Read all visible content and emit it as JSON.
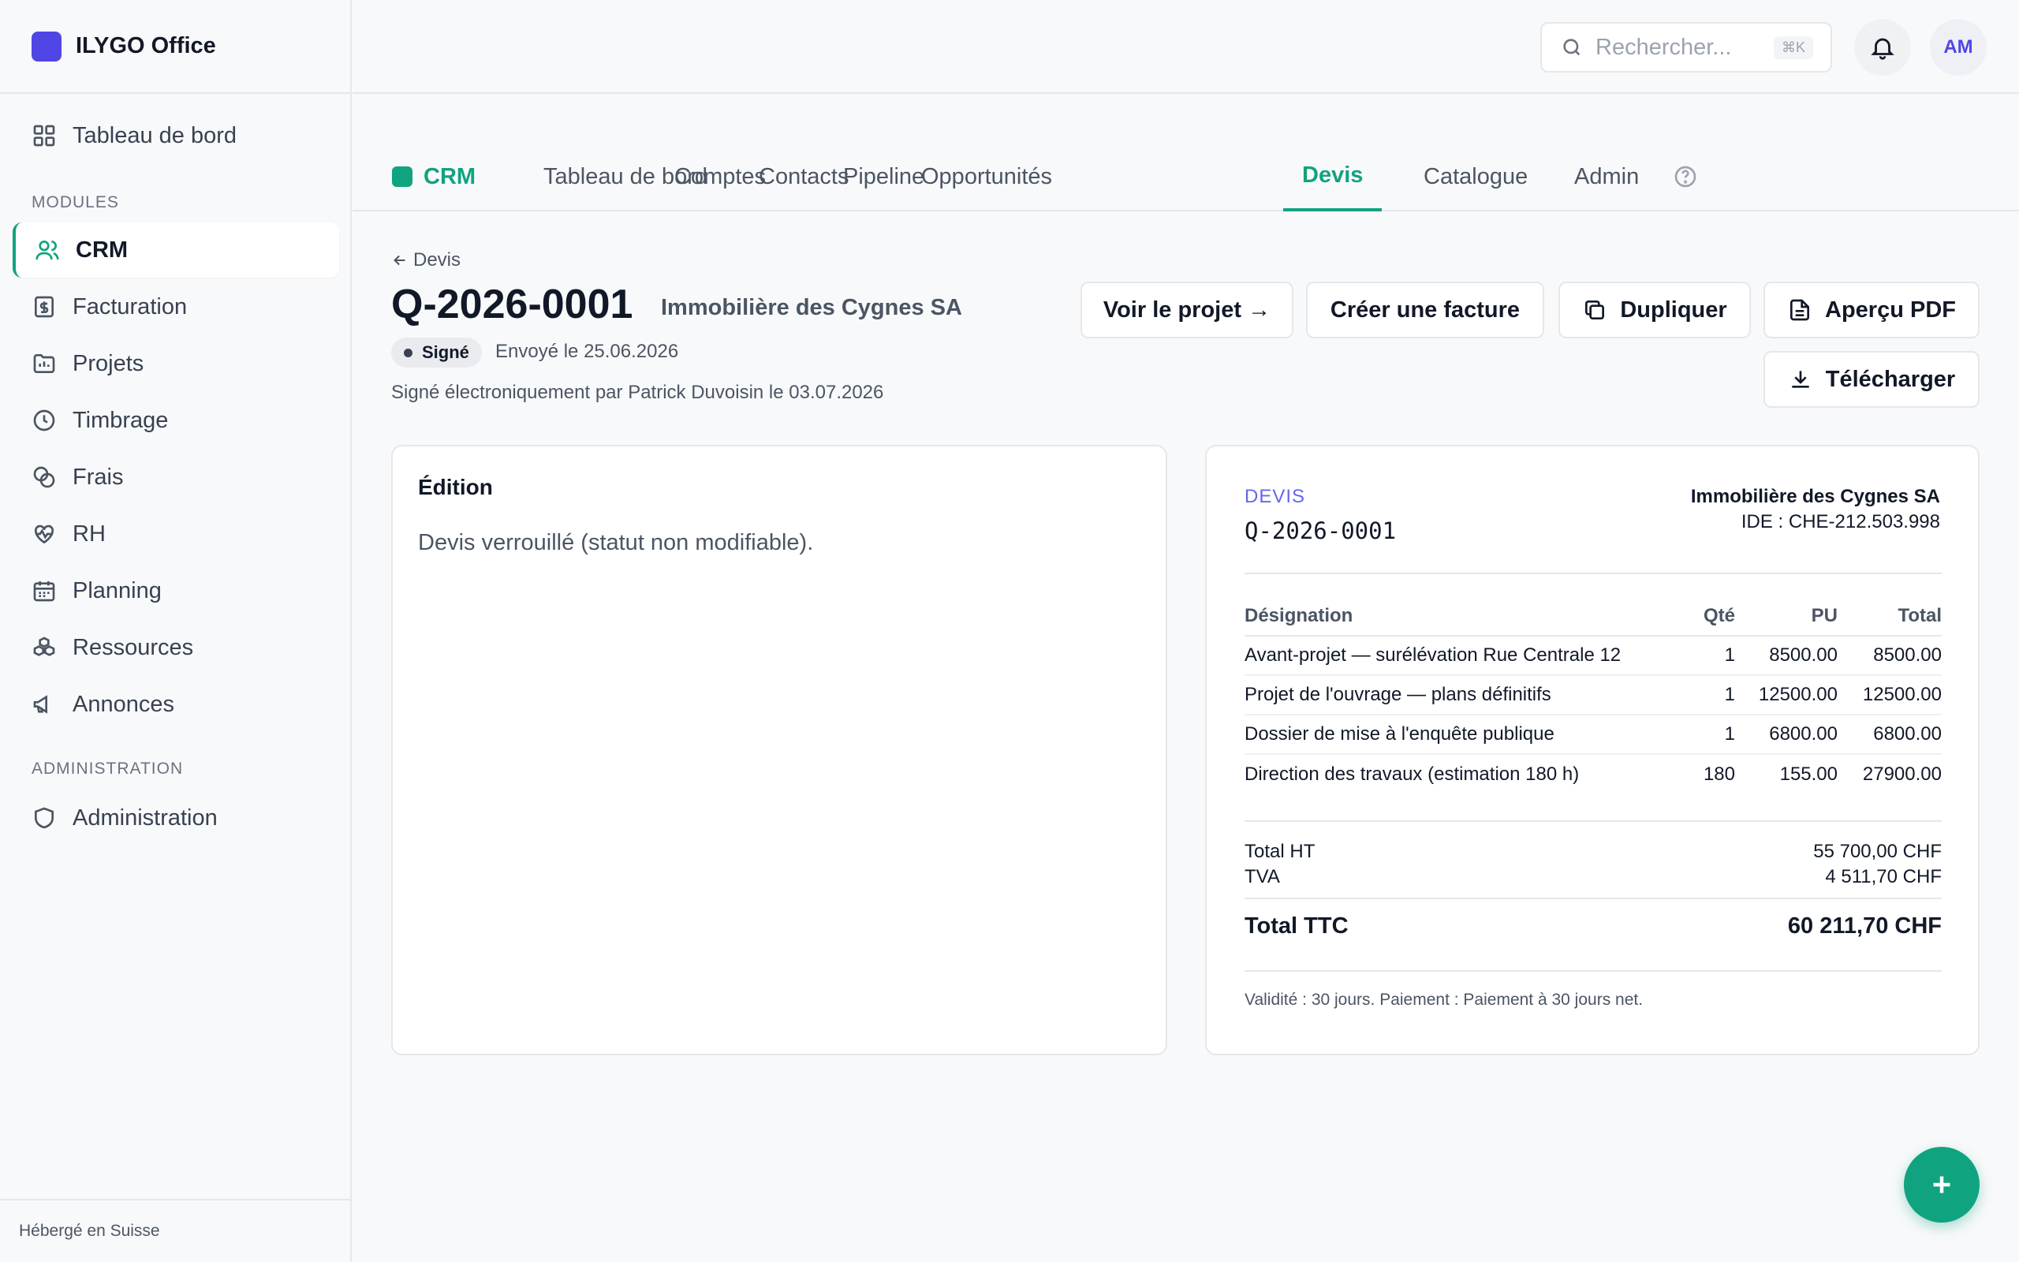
{
  "app": {
    "name": "ILYGO Office"
  },
  "sidebar": {
    "dashboard": "Tableau de bord",
    "modules_label": "MODULES",
    "items": [
      {
        "label": "CRM",
        "icon": "users-icon"
      },
      {
        "label": "Facturation",
        "icon": "invoice-icon"
      },
      {
        "label": "Projets",
        "icon": "folder-icon"
      },
      {
        "label": "Timbrage",
        "icon": "clock-icon"
      },
      {
        "label": "Frais",
        "icon": "coins-icon"
      },
      {
        "label": "RH",
        "icon": "heart-pulse-icon"
      },
      {
        "label": "Planning",
        "icon": "calendar-icon"
      },
      {
        "label": "Ressources",
        "icon": "boxes-icon"
      },
      {
        "label": "Annonces",
        "icon": "megaphone-icon"
      }
    ],
    "admin_label": "ADMINISTRATION",
    "admin_item": "Administration",
    "footer": "Hébergé en Suisse"
  },
  "topbar": {
    "search_placeholder": "Rechercher...",
    "search_shortcut": "⌘K",
    "avatar_initials": "AM"
  },
  "tabs": {
    "module": "CRM",
    "items": [
      "Tableau de bord",
      "Comptes",
      "Contacts",
      "Pipeline",
      "Opportunités",
      "Devis",
      "Catalogue",
      "Admin"
    ],
    "active": "Devis"
  },
  "quote": {
    "back_label": "Devis",
    "number": "Q-2026-0001",
    "client": "Immobilière des Cygnes SA",
    "status": "Signé",
    "sent": "Envoyé le 25.06.2026",
    "signed_note": "Signé électroniquement par Patrick Duvoisin le 03.07.2026"
  },
  "actions": {
    "view_project": "Voir le projet →",
    "create_invoice": "Créer une facture",
    "duplicate": "Dupliquer",
    "pdf_preview": "Aperçu PDF",
    "download": "Télécharger"
  },
  "edit_card": {
    "title": "Édition",
    "message": "Devis verrouillé (statut non modifiable)."
  },
  "preview": {
    "label": "DEVIS",
    "number": "Q-2026-0001",
    "client": "Immobilière des Cygnes SA",
    "ide": "IDE : CHE-212.503.998",
    "columns": [
      "Désignation",
      "Qté",
      "PU",
      "Total"
    ],
    "rows": [
      [
        "Avant-projet — surélévation Rue Centrale 12",
        "1",
        "8500.00",
        "8500.00"
      ],
      [
        "Projet de l'ouvrage — plans définitifs",
        "1",
        "12500.00",
        "12500.00"
      ],
      [
        "Dossier de mise à l'enquête publique",
        "1",
        "6800.00",
        "6800.00"
      ],
      [
        "Direction des travaux (estimation 180 h)",
        "180",
        "155.00",
        "27900.00"
      ]
    ],
    "total_ht_label": "Total HT",
    "total_ht": "55 700,00 CHF",
    "tva_label": "TVA",
    "tva": "4 511,70 CHF",
    "total_ttc_label": "Total TTC",
    "total_ttc": "60 211,70 CHF",
    "footer": "Validité : 30 jours. Paiement : Paiement à 30 jours net."
  },
  "colors": {
    "accent": "#10a37f",
    "brand": "#4f46e5",
    "label": "#6366f1"
  }
}
